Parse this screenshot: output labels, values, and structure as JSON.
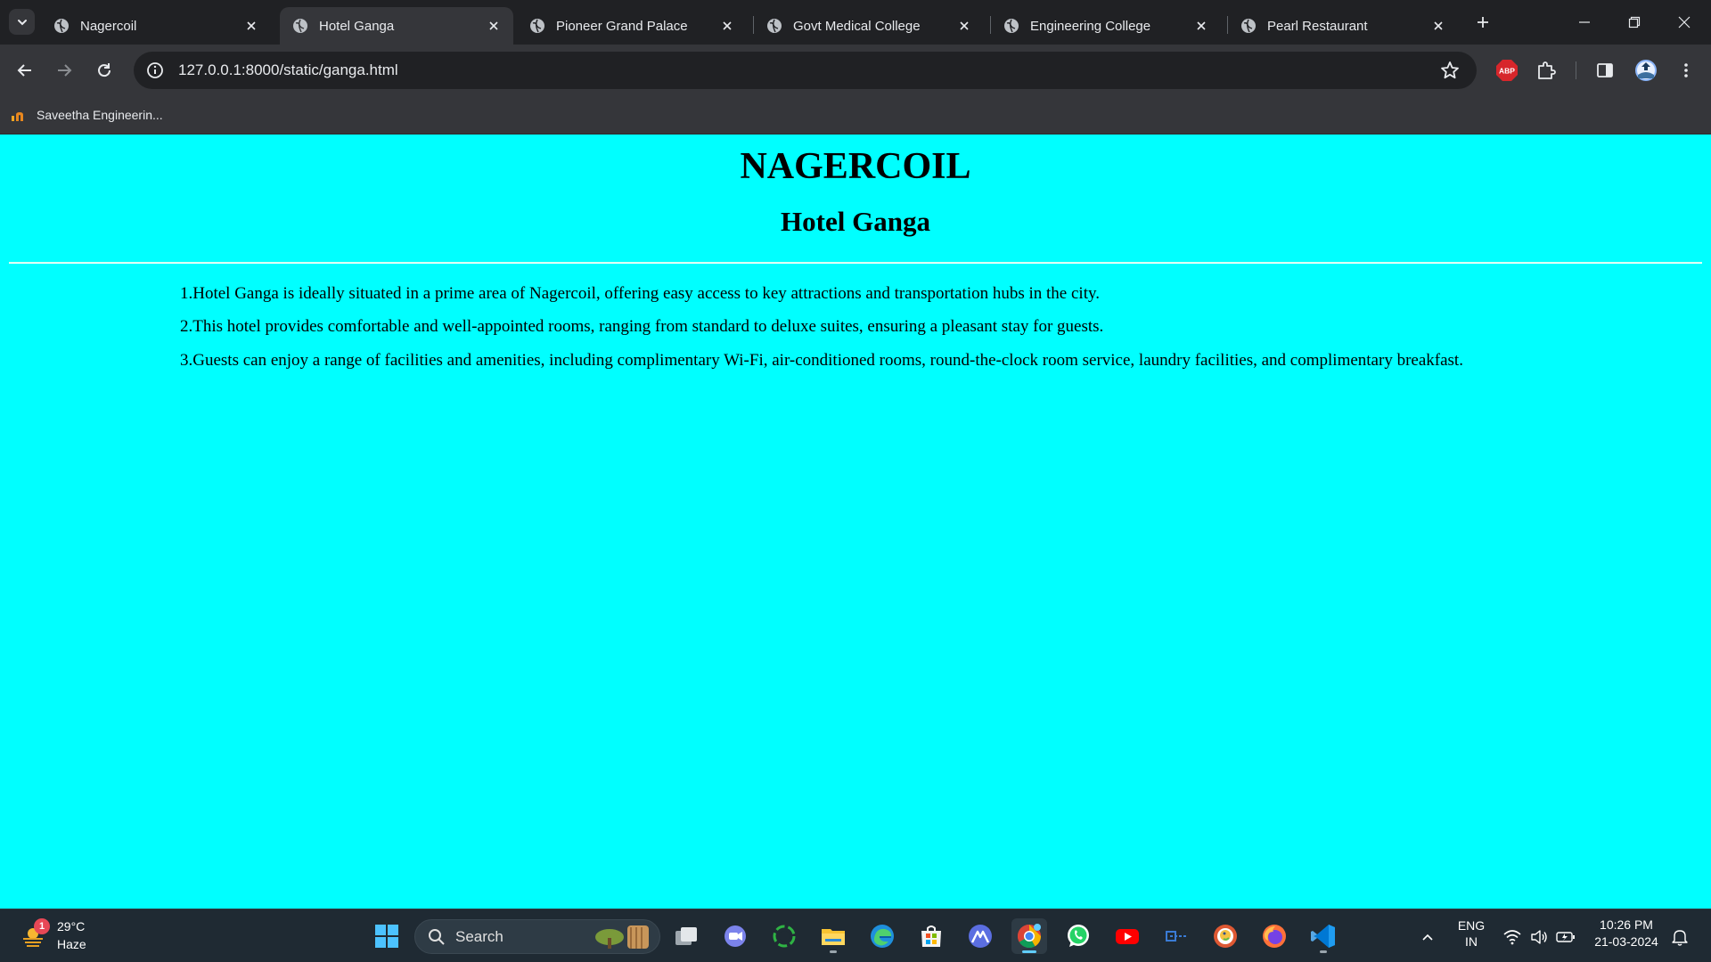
{
  "browser": {
    "tabs": [
      {
        "title": "Nagercoil",
        "active": false
      },
      {
        "title": "Hotel Ganga",
        "active": true
      },
      {
        "title": "Pioneer Grand Palace",
        "active": false
      },
      {
        "title": "Govt Medical College",
        "active": false
      },
      {
        "title": "Engineering College",
        "active": false
      },
      {
        "title": "Pearl Restaurant",
        "active": false
      }
    ],
    "url": "127.0.0.1:8000/static/ganga.html",
    "bookmarks": [
      {
        "label": "Saveetha Engineerin..."
      }
    ],
    "extension_abp_label": "ABP"
  },
  "page": {
    "heading": "NAGERCOIL",
    "subheading": "Hotel Ganga",
    "paragraphs": [
      "1.Hotel Ganga is ideally situated in a prime area of Nagercoil, offering easy access to key attractions and transportation hubs in the city.",
      "2.This hotel provides comfortable and well-appointed rooms, ranging from standard to deluxe suites, ensuring a pleasant stay for guests.",
      "3.Guests can enjoy a range of facilities and amenities, including complimentary Wi-Fi, air-conditioned rooms, round-the-clock room service, laundry facilities, and complimentary breakfast."
    ],
    "background_color": "#00ffff"
  },
  "taskbar": {
    "weather": {
      "temp": "29°C",
      "condition": "Haze",
      "badge": "1"
    },
    "search_label": "Search",
    "language": {
      "line1": "ENG",
      "line2": "IN"
    },
    "clock": {
      "time": "10:26 PM",
      "date": "21-03-2024"
    },
    "apps": [
      "windows-start",
      "task-view",
      "teams-chat",
      "cycle-app",
      "file-explorer",
      "edge",
      "microsoft-store",
      "app-launcher",
      "chrome",
      "whatsapp",
      "youtube",
      "app-dash",
      "duckduckgo",
      "firefox",
      "vscode"
    ]
  }
}
